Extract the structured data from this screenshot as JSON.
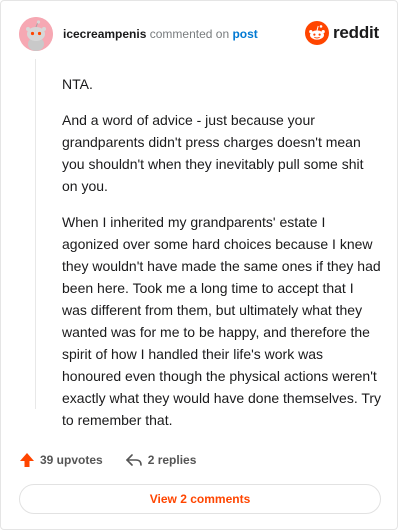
{
  "header": {
    "username": "icecreampenis",
    "commented_on": "commented on",
    "post_link": "post",
    "brand": "reddit"
  },
  "comment": {
    "paragraphs": [
      "NTA.",
      "And a word of advice - just because your grandparents didn't press charges doesn't mean you shouldn't when they inevitably pull some shit on you.",
      "When I inherited my grandparents' estate I agonized over some hard choices because I knew they wouldn't have made the same ones if they had been here. Took me a long time to accept that I was different from them, but ultimately what they wanted was for me to be happy, and therefore the spirit of how I handled their life's work was honoured even though the physical actions weren't exactly what they would have done themselves. Try to remember that."
    ]
  },
  "actions": {
    "upvotes": "39 upvotes",
    "replies": "2 replies"
  },
  "view_comments": "View 2 comments",
  "colors": {
    "accent": "#ff4500",
    "link": "#0079d3",
    "avatar_bg": "#f6a8b3"
  },
  "icons": {
    "avatar": "snoo-avatar-icon",
    "brand": "reddit-logo-icon",
    "upvote": "upvote-arrow-icon",
    "reply": "reply-arrow-icon"
  }
}
